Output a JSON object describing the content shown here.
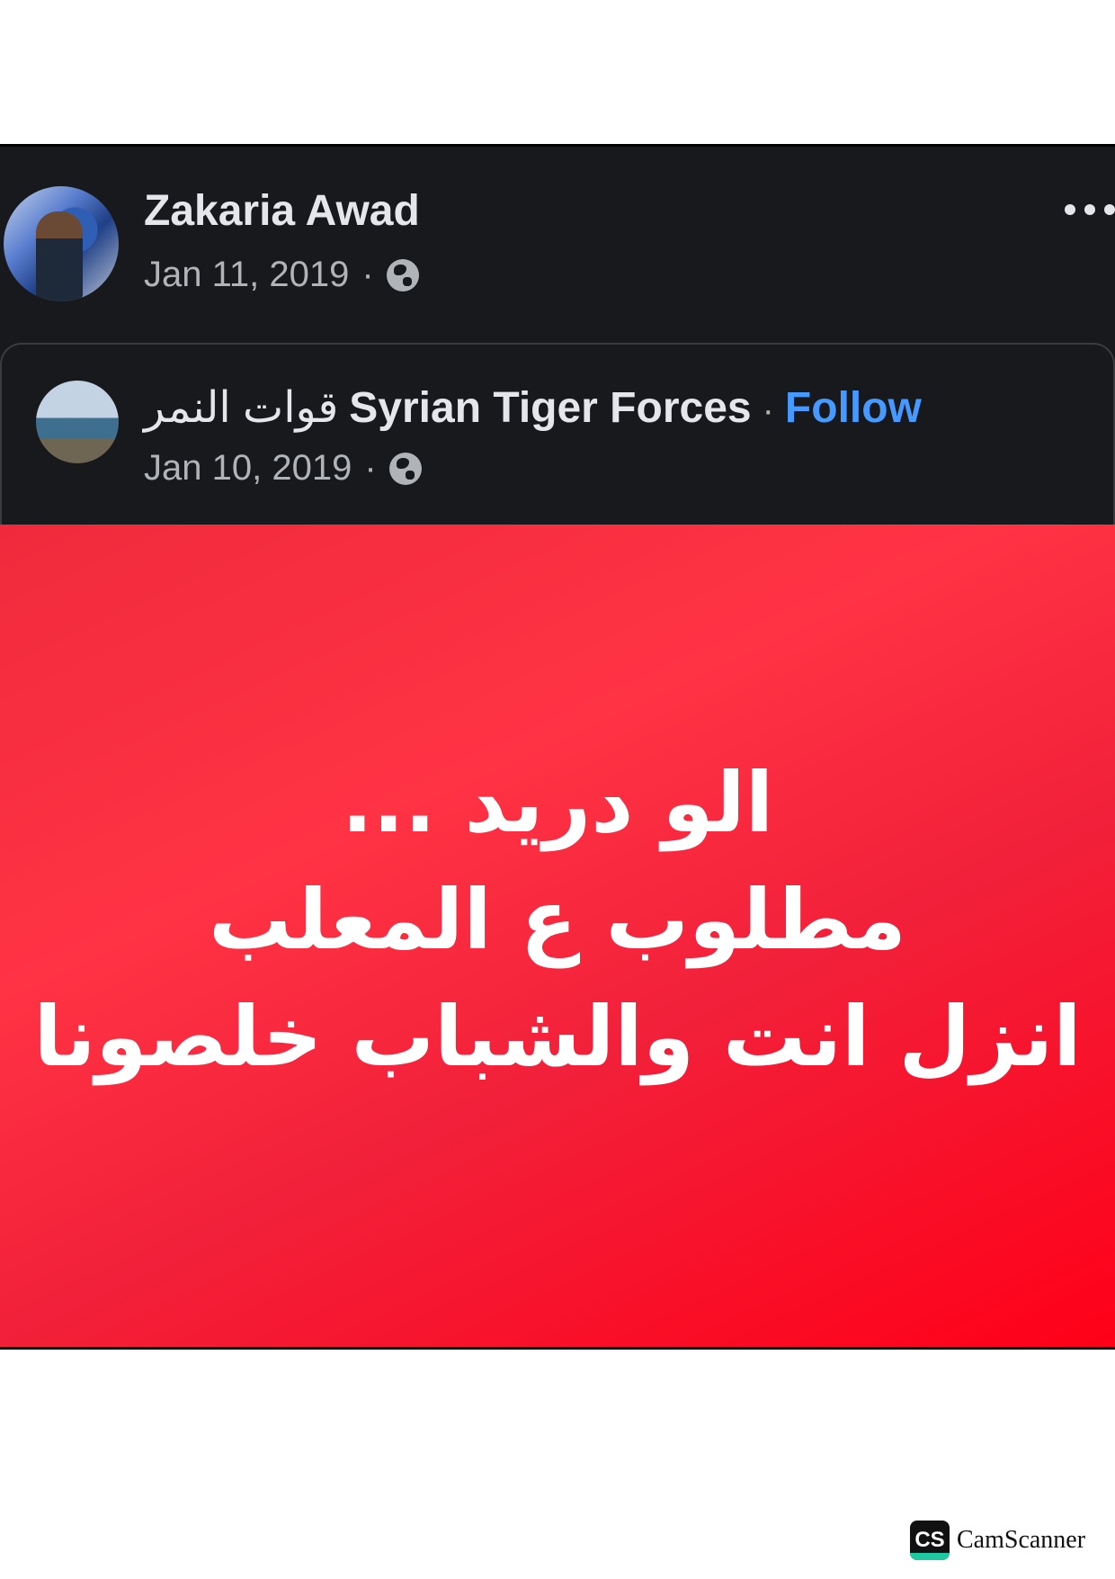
{
  "post": {
    "author_name": "Zakaria Awad",
    "date": "Jan 11, 2019",
    "separator": "·",
    "privacy_icon": "globe-icon",
    "more_icon": "more-options-icon"
  },
  "shared_post": {
    "page_name_arabic": "قوات النمر",
    "page_name": "Syrian Tiger Forces",
    "separator": "·",
    "follow_label": "Follow",
    "date": "Jan 10, 2019",
    "privacy_icon": "globe-icon",
    "image_lines": [
      "الو دريد ...",
      "مطلوب ع المعلب",
      "انزل انت والشباب خلصونا"
    ]
  },
  "watermark": {
    "badge": "CS",
    "text": "CamScanner"
  },
  "colors": {
    "background": "#18191c",
    "follow_link": "#4599ff",
    "image_red": "#ff2a3c"
  }
}
